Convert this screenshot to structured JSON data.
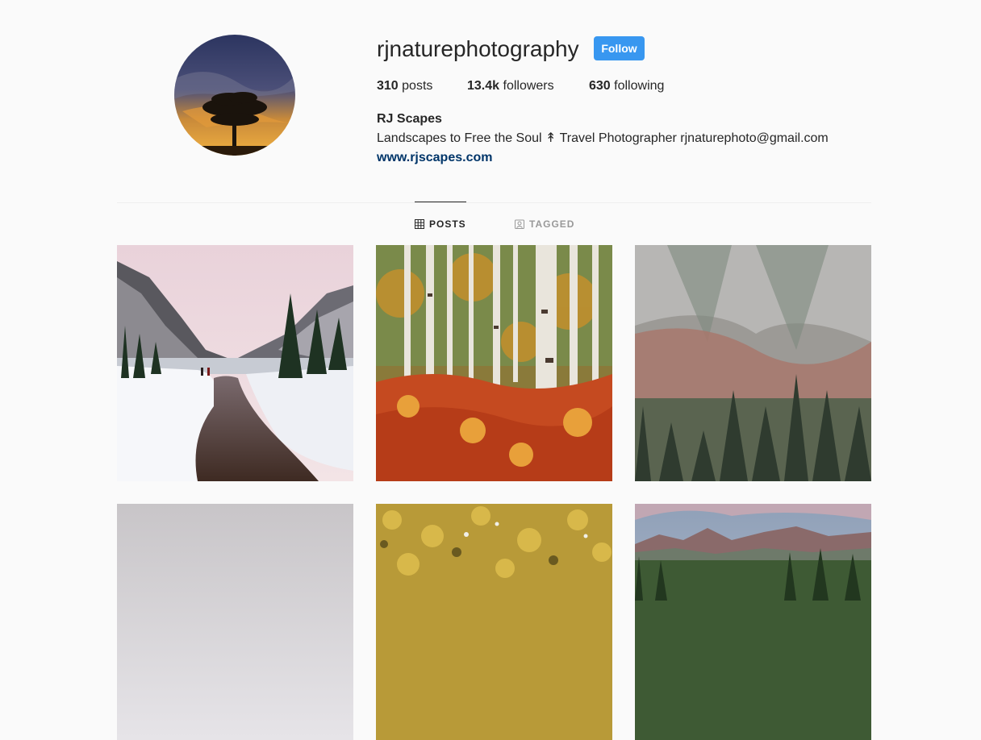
{
  "profile": {
    "username": "rjnaturephotography",
    "follow_label": "Follow",
    "stats": {
      "posts_count": "310",
      "posts_label": "posts",
      "followers_count": "13.4k",
      "followers_label": "followers",
      "following_count": "630",
      "following_label": "following"
    },
    "full_name": "RJ Scapes",
    "bio": "Landscapes to Free the Soul ↟ Travel Photographer rjnaturephoto@gmail.com",
    "website": "www.rjscapes.com"
  },
  "tabs": [
    {
      "label": "POSTS",
      "icon": "grid-icon",
      "active": true
    },
    {
      "label": "TAGGED",
      "icon": "tagged-icon",
      "active": false
    }
  ],
  "colors": {
    "follow_button": "#3897f0",
    "link": "#003569",
    "text": "#262626",
    "muted": "#999999",
    "background": "#fafafa"
  }
}
